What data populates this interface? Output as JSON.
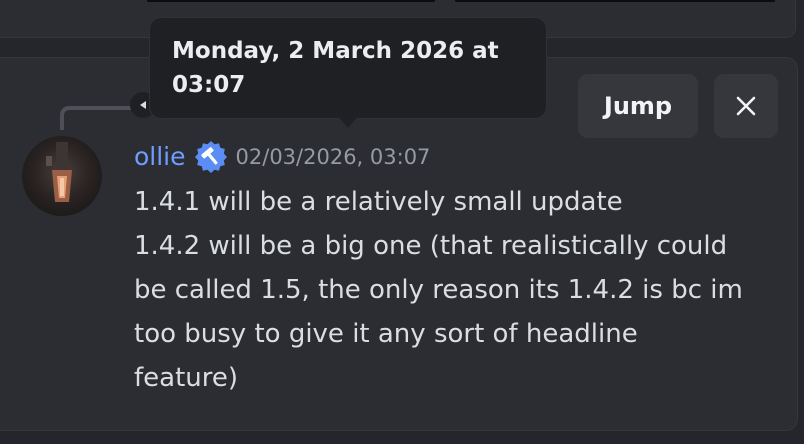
{
  "message": {
    "author": "ollie",
    "timestamp": "02/03/2026, 03:07",
    "lines": [
      "1.4.1 will be a relatively small update",
      "1.4.2 will be a big one (that realistically could",
      "be called 1.5, the only reason its 1.4.2 is bc im",
      "too busy to give it any sort of headline",
      "feature)"
    ]
  },
  "tooltip": {
    "line1": "Monday, 2 March 2026 at",
    "line2": "03:07"
  },
  "actions": {
    "jump_label": "Jump",
    "close_icon": "close-icon"
  },
  "reply": {
    "arrow_icon": "reply-arrow-icon"
  },
  "badge": {
    "icon": "hammer-icon",
    "color": "#5b8df5"
  },
  "colors": {
    "username": "#6f9cff",
    "background": "#25262b",
    "card": "#2c2d32",
    "button": "#36373d",
    "tooltip": "#1f2024"
  }
}
